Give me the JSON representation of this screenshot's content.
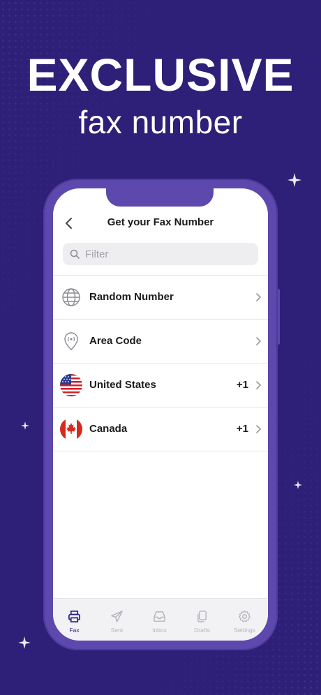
{
  "promo": {
    "headline": "EXCLUSIVE",
    "subhead": "fax number"
  },
  "screen": {
    "title": "Get your Fax Number",
    "search": {
      "placeholder": "Filter",
      "value": ""
    },
    "items": [
      {
        "label": "Random Number",
        "icon": "globe-icon",
        "code": ""
      },
      {
        "label": "Area Code",
        "icon": "location-pin-icon",
        "code": ""
      },
      {
        "label": "United States",
        "icon": "us-flag-icon",
        "code": "+1"
      },
      {
        "label": "Canada",
        "icon": "canada-flag-icon",
        "code": "+1"
      }
    ],
    "tabs": [
      {
        "label": "Fax",
        "icon": "printer-icon",
        "active": true
      },
      {
        "label": "Sent",
        "icon": "paper-plane-icon",
        "active": false
      },
      {
        "label": "Inbox",
        "icon": "inbox-tray-icon",
        "active": false
      },
      {
        "label": "Drafts",
        "icon": "documents-icon",
        "active": false
      },
      {
        "label": "Settings",
        "icon": "gear-icon",
        "active": false
      }
    ]
  },
  "colors": {
    "background": "#2e1f78",
    "phone_frame": "#5d48ad",
    "active_tab": "#2a2087",
    "inactive_tab": "#b4b4bc"
  }
}
